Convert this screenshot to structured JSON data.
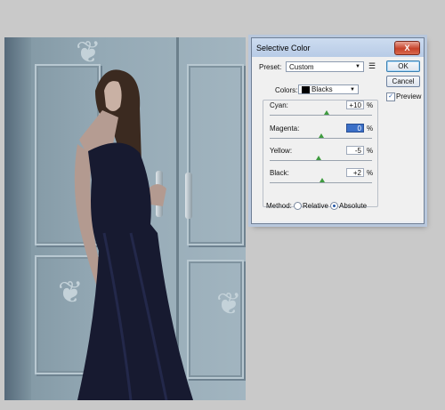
{
  "dialog": {
    "title": "Selective Color",
    "close_glyph": "X",
    "preset_label": "Preset:",
    "preset_value": "Custom",
    "ok_label": "OK",
    "cancel_label": "Cancel",
    "preview_label": "Preview",
    "preview_checked": true,
    "colors_label": "Colors:",
    "colors_value": "Blacks",
    "sliders": [
      {
        "label": "Cyan:",
        "value": "+10",
        "unit": "%"
      },
      {
        "label": "Magenta:",
        "value": "0",
        "unit": "%"
      },
      {
        "label": "Yellow:",
        "value": "-5",
        "unit": "%"
      },
      {
        "label": "Black:",
        "value": "+2",
        "unit": "%"
      }
    ],
    "method_label": "Method:",
    "method_options": [
      "Relative",
      "Absolute"
    ],
    "method_selected": "Absolute"
  },
  "icons": {
    "preset_menu": "list-options-icon",
    "dropdown": "chevron-down-icon"
  },
  "colors": {
    "accent": "#3b6fc7",
    "slider_thumb": "#3f9b3f"
  }
}
